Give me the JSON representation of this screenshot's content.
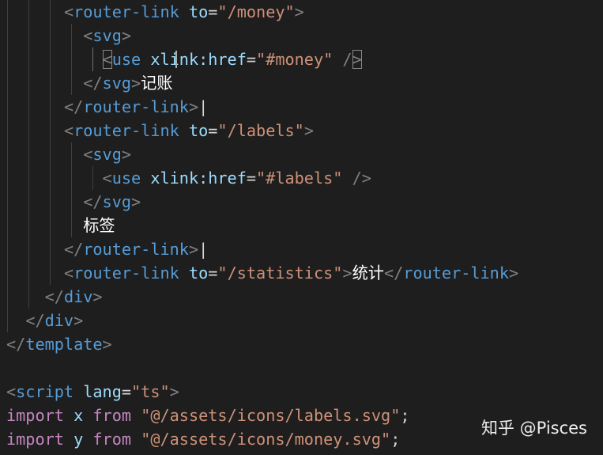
{
  "editor": {
    "lines": [
      {
        "indent": "      ",
        "parts": [
          [
            "t",
            "<"
          ],
          [
            "tg",
            "router-link"
          ],
          [
            "t",
            " "
          ],
          [
            "at",
            "to"
          ],
          [
            "eq",
            "="
          ],
          [
            "st",
            "\"/money\""
          ],
          [
            "t",
            ">"
          ]
        ]
      },
      {
        "indent": "        ",
        "parts": [
          [
            "t",
            "<"
          ],
          [
            "tg",
            "svg"
          ],
          [
            "t",
            ">"
          ]
        ]
      },
      {
        "indent": "          ",
        "parts": [
          [
            "tbox",
            "<"
          ],
          [
            "tg",
            "use"
          ],
          [
            "t",
            " "
          ],
          [
            "at",
            "xlink:href"
          ],
          [
            "eq",
            "="
          ],
          [
            "st",
            "\"#money\""
          ],
          [
            "t",
            " /"
          ],
          [
            "tbox",
            ">"
          ]
        ]
      },
      {
        "indent": "        ",
        "parts": [
          [
            "t",
            "</"
          ],
          [
            "tg",
            "svg"
          ],
          [
            "t",
            ">"
          ],
          [
            "cn",
            "记账"
          ]
        ]
      },
      {
        "indent": "      ",
        "parts": [
          [
            "t",
            "</"
          ],
          [
            "tg",
            "router-link"
          ],
          [
            "t",
            ">"
          ],
          [
            "cursor",
            "|"
          ]
        ]
      },
      {
        "indent": "      ",
        "parts": [
          [
            "t",
            "<"
          ],
          [
            "tg",
            "router-link"
          ],
          [
            "t",
            " "
          ],
          [
            "at",
            "to"
          ],
          [
            "eq",
            "="
          ],
          [
            "st",
            "\"/labels\""
          ],
          [
            "t",
            ">"
          ]
        ]
      },
      {
        "indent": "        ",
        "parts": [
          [
            "t",
            "<"
          ],
          [
            "tg",
            "svg"
          ],
          [
            "t",
            ">"
          ]
        ]
      },
      {
        "indent": "          ",
        "parts": [
          [
            "t",
            "<"
          ],
          [
            "tg",
            "use"
          ],
          [
            "t",
            " "
          ],
          [
            "at",
            "xlink:href"
          ],
          [
            "eq",
            "="
          ],
          [
            "st",
            "\"#labels\""
          ],
          [
            "t",
            " />"
          ]
        ]
      },
      {
        "indent": "        ",
        "parts": [
          [
            "t",
            "</"
          ],
          [
            "tg",
            "svg"
          ],
          [
            "t",
            ">"
          ]
        ]
      },
      {
        "indent": "        ",
        "parts": [
          [
            "cn",
            "标签"
          ]
        ]
      },
      {
        "indent": "      ",
        "parts": [
          [
            "t",
            "</"
          ],
          [
            "tg",
            "router-link"
          ],
          [
            "t",
            ">"
          ],
          [
            "cursor",
            "|"
          ]
        ]
      },
      {
        "indent": "      ",
        "parts": [
          [
            "t",
            "<"
          ],
          [
            "tg",
            "router-link"
          ],
          [
            "t",
            " "
          ],
          [
            "at",
            "to"
          ],
          [
            "eq",
            "="
          ],
          [
            "st",
            "\"/statistics\""
          ],
          [
            "t",
            ">"
          ],
          [
            "cn",
            "统计"
          ],
          [
            "t",
            "</"
          ],
          [
            "tg",
            "router-link"
          ],
          [
            "t",
            ">"
          ]
        ]
      },
      {
        "indent": "    ",
        "parts": [
          [
            "t",
            "</"
          ],
          [
            "tg",
            "div"
          ],
          [
            "t",
            ">"
          ]
        ]
      },
      {
        "indent": "  ",
        "parts": [
          [
            "t",
            "</"
          ],
          [
            "tg",
            "div"
          ],
          [
            "t",
            ">"
          ]
        ]
      },
      {
        "indent": "",
        "parts": [
          [
            "t",
            "</"
          ],
          [
            "tg",
            "template"
          ],
          [
            "t",
            ">"
          ]
        ]
      },
      {
        "indent": "",
        "parts": []
      },
      {
        "indent": "",
        "parts": [
          [
            "t",
            "<"
          ],
          [
            "tg",
            "script"
          ],
          [
            "t",
            " "
          ],
          [
            "at",
            "lang"
          ],
          [
            "eq",
            "="
          ],
          [
            "st",
            "\"ts\""
          ],
          [
            "t",
            ">"
          ]
        ]
      },
      {
        "indent": "",
        "parts": [
          [
            "kw",
            "import"
          ],
          [
            "t",
            " "
          ],
          [
            "id",
            "x"
          ],
          [
            "t",
            " "
          ],
          [
            "kw",
            "from"
          ],
          [
            "t",
            " "
          ],
          [
            "st",
            "\"@/assets/icons/labels.svg\""
          ],
          [
            "eq",
            ";"
          ]
        ]
      },
      {
        "indent": "",
        "parts": [
          [
            "kw",
            "import"
          ],
          [
            "t",
            " "
          ],
          [
            "id",
            "y"
          ],
          [
            "t",
            " "
          ],
          [
            "kw",
            "from"
          ],
          [
            "t",
            " "
          ],
          [
            "st",
            "\"@/assets/icons/money.svg\""
          ],
          [
            "eq",
            ";"
          ]
        ]
      }
    ]
  },
  "watermark": {
    "text": "知乎 @Pisces"
  }
}
